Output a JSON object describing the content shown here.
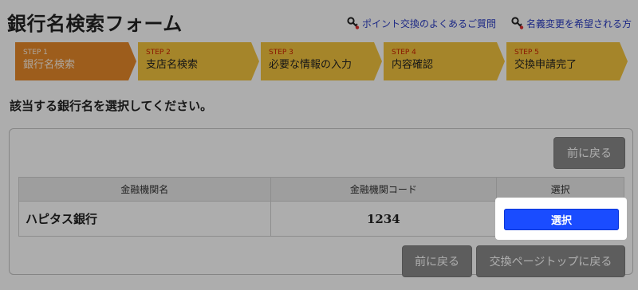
{
  "header": {
    "title": "銀行名検索フォーム",
    "links": [
      {
        "label": "ポイント交換のよくあるご質問",
        "icon": "key-icon"
      },
      {
        "label": "名義変更を希望される方",
        "icon": "key-icon"
      }
    ]
  },
  "steps": [
    {
      "num": "STEP 1",
      "label": "銀行名検索",
      "active": true
    },
    {
      "num": "STEP 2",
      "label": "支店名検索",
      "active": false
    },
    {
      "num": "STEP 3",
      "label": "必要な情報の入力",
      "active": false
    },
    {
      "num": "STEP 4",
      "label": "内容確認",
      "active": false
    },
    {
      "num": "STEP 5",
      "label": "交換申請完了",
      "active": false
    }
  ],
  "instruction": "該当する銀行名を選択してください。",
  "panel": {
    "back_top_label": "前に戻る",
    "table": {
      "headers": [
        "金融機関名",
        "金融機関コード",
        "選択"
      ],
      "rows": [
        {
          "name": "ハピタス銀行",
          "code": "1234",
          "select_label": "選択"
        }
      ]
    },
    "back_bottom_label": "前に戻る",
    "exchange_top_label": "交換ページトップに戻る"
  },
  "colors": {
    "step_active": "#e8892a",
    "step_inactive": "#f3c43e",
    "select_button": "#1a4cff",
    "link": "#2a3cc4"
  }
}
